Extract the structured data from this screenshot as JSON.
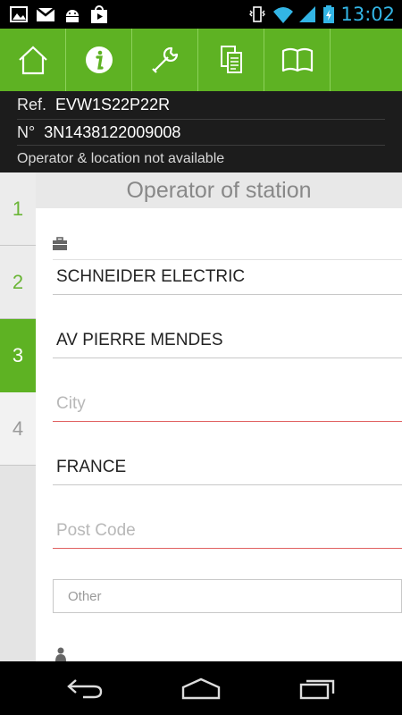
{
  "status_bar": {
    "left_icons": [
      "image-icon",
      "gmail-icon",
      "android-icon",
      "play-store-icon"
    ],
    "right_icons": [
      "vibrate-icon",
      "wifi-icon",
      "signal-icon",
      "battery-charging-icon"
    ],
    "time": "13:02",
    "clock_color": "#33b5e5"
  },
  "toolbar": {
    "accent": "#5eb223",
    "buttons": [
      "home-icon",
      "info-icon",
      "wrench-icon",
      "documents-icon",
      "book-icon"
    ]
  },
  "info": {
    "ref_label": "Ref.",
    "ref_value": "EVW1S22P22R",
    "number_label": "N°",
    "number_value": "3N1438122009008",
    "note": "Operator & location not available"
  },
  "steps": [
    "1",
    "2",
    "3",
    "4"
  ],
  "active_step": "3",
  "section_title": "Operator of station",
  "form": {
    "company": "SCHNEIDER ELECTRIC",
    "street": "AV PIERRE MENDES",
    "city_placeholder": "City",
    "country": "FRANCE",
    "postcode_placeholder": "Post Code",
    "other_placeholder": "Other"
  },
  "nav_bar": {
    "buttons": [
      "back-icon",
      "home-nav-icon",
      "recent-apps-icon"
    ]
  }
}
